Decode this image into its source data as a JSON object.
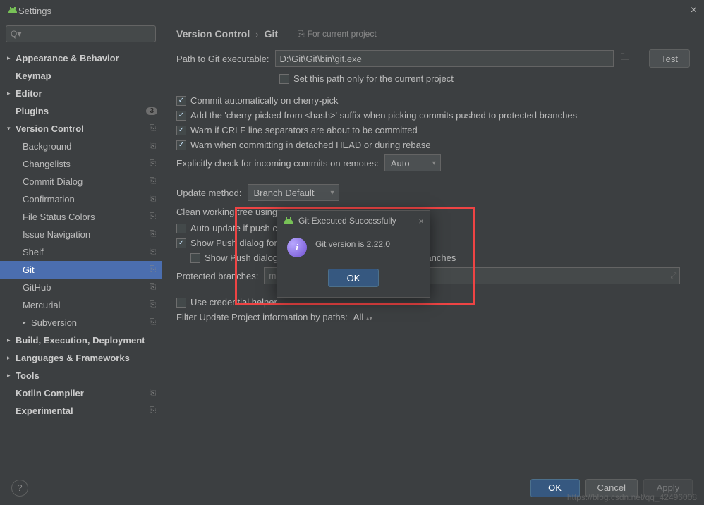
{
  "window": {
    "title": "Settings"
  },
  "search": {
    "placeholder": ""
  },
  "sidebar": {
    "items": [
      {
        "label": "Appearance & Behavior",
        "bold": true,
        "arrow": "▸",
        "level": 0
      },
      {
        "label": "Keymap",
        "bold": true,
        "level": 0,
        "pad": true
      },
      {
        "label": "Editor",
        "bold": true,
        "arrow": "▸",
        "level": 0
      },
      {
        "label": "Plugins",
        "bold": true,
        "level": 0,
        "badge": "3",
        "pad": true
      },
      {
        "label": "Version Control",
        "bold": true,
        "arrow": "▾",
        "level": 0,
        "proj": true
      },
      {
        "label": "Background",
        "level": 1,
        "proj": true
      },
      {
        "label": "Changelists",
        "level": 1,
        "proj": true
      },
      {
        "label": "Commit Dialog",
        "level": 1,
        "proj": true
      },
      {
        "label": "Confirmation",
        "level": 1,
        "proj": true
      },
      {
        "label": "File Status Colors",
        "level": 1,
        "proj": true
      },
      {
        "label": "Issue Navigation",
        "level": 1,
        "proj": true
      },
      {
        "label": "Shelf",
        "level": 1,
        "proj": true
      },
      {
        "label": "Git",
        "level": 1,
        "proj": true,
        "selected": true
      },
      {
        "label": "GitHub",
        "level": 1,
        "proj": true
      },
      {
        "label": "Mercurial",
        "level": 1,
        "proj": true
      },
      {
        "label": "Subversion",
        "level": 1,
        "arrow": "▸",
        "proj": true
      },
      {
        "label": "Build, Execution, Deployment",
        "bold": true,
        "arrow": "▸",
        "level": 0
      },
      {
        "label": "Languages & Frameworks",
        "bold": true,
        "arrow": "▸",
        "level": 0
      },
      {
        "label": "Tools",
        "bold": true,
        "arrow": "▸",
        "level": 0
      },
      {
        "label": "Kotlin Compiler",
        "bold": true,
        "level": 0,
        "proj": true,
        "pad": true
      },
      {
        "label": "Experimental",
        "bold": true,
        "level": 0,
        "proj": true,
        "pad": true
      }
    ]
  },
  "breadcrumb": {
    "a": "Version Control",
    "b": "Git",
    "hint": "For current project"
  },
  "path": {
    "label": "Path to Git executable:",
    "value": "D:\\Git\\Git\\bin\\git.exe",
    "test": "Test",
    "only": "Set this path only for the current project"
  },
  "checks": {
    "c1": "Commit automatically on cherry-pick",
    "c2": "Add the 'cherry-picked from <hash>' suffix when picking commits pushed to protected branches",
    "c3": "Warn if CRLF line separators are about to be committed",
    "c4": "Warn when committing in detached HEAD or during rebase"
  },
  "explicit": {
    "label": "Explicitly check for incoming commits on remotes:",
    "value": "Auto"
  },
  "update": {
    "label": "Update method:",
    "value": "Branch Default"
  },
  "clean": {
    "label": "Clean working tree using"
  },
  "auto": {
    "label": "Auto-update if push c"
  },
  "push": {
    "label": "Show Push dialog for",
    "sub": "Show Push dialog",
    "tail": "ranches"
  },
  "protected": {
    "label": "Protected branches:",
    "value": "master"
  },
  "cred": {
    "label": "Use credential helper"
  },
  "filter": {
    "label": "Filter Update Project information by paths:",
    "value": "All"
  },
  "footer": {
    "ok": "OK",
    "cancel": "Cancel",
    "apply": "Apply"
  },
  "dialog": {
    "title": "Git Executed Successfully",
    "message": "Git version is 2.22.0",
    "ok": "OK"
  },
  "watermark": "https://blog.csdn.net/qq_42496008"
}
